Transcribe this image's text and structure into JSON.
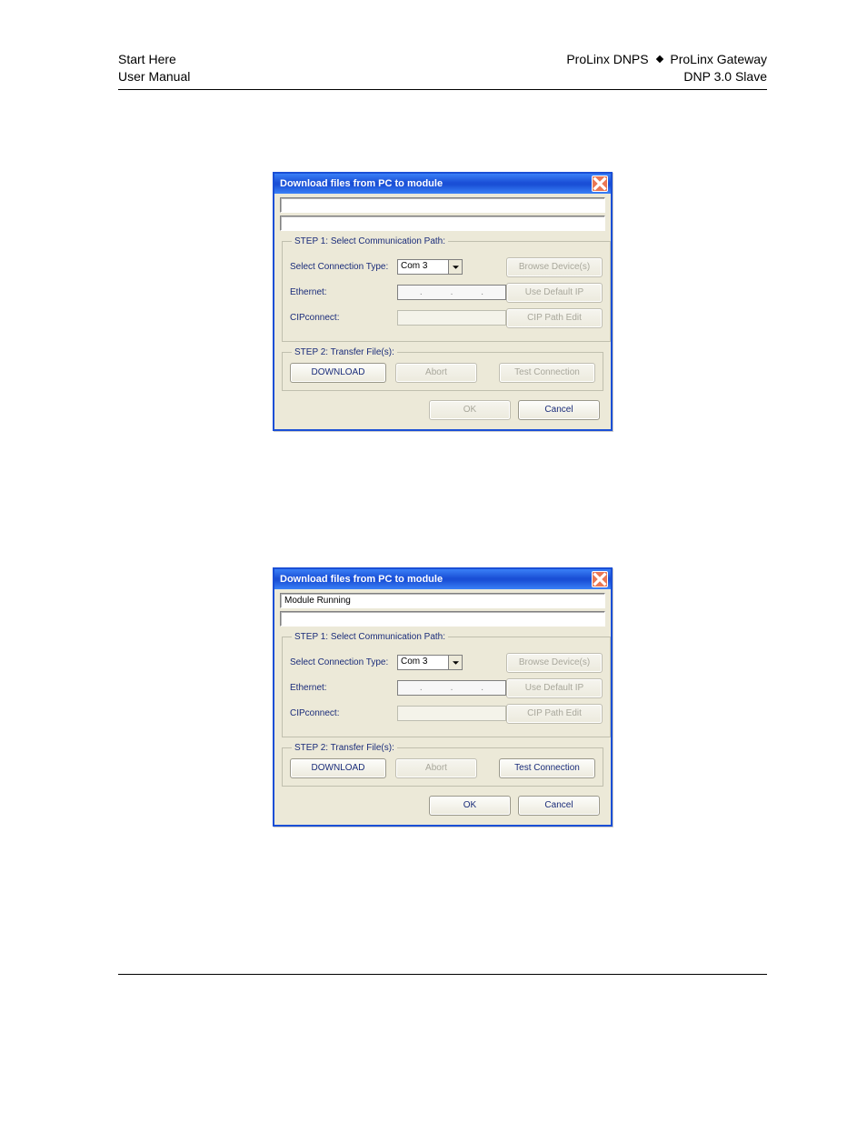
{
  "header": {
    "left_line1": "Start Here",
    "left_line2": "User Manual",
    "right_line1_a": "ProLinx DNPS",
    "right_line1_b": "ProLinx Gateway",
    "right_line2": "DNP 3.0 Slave"
  },
  "dialog1": {
    "title": "Download files from PC to module",
    "status1": "",
    "status2": "",
    "step1_legend": "STEP 1: Select Communication Path:",
    "select_conn_label": "Select Connection Type:",
    "select_conn_value": "Com 3",
    "browse_devices": "Browse Device(s)",
    "ethernet_label": "Ethernet:",
    "use_default_ip": "Use Default IP",
    "cipconnect_label": "CIPconnect:",
    "cip_path_edit": "CIP Path Edit",
    "step2_legend": "STEP 2: Transfer File(s):",
    "download": "DOWNLOAD",
    "abort": "Abort",
    "test_connection": "Test Connection",
    "ok": "OK",
    "cancel": "Cancel"
  },
  "dialog2": {
    "title": "Download files from PC to module",
    "status1": "Module Running",
    "status2": "",
    "step1_legend": "STEP 1: Select Communication Path:",
    "select_conn_label": "Select Connection Type:",
    "select_conn_value": "Com 3",
    "browse_devices": "Browse Device(s)",
    "ethernet_label": "Ethernet:",
    "use_default_ip": "Use Default IP",
    "cipconnect_label": "CIPconnect:",
    "cip_path_edit": "CIP Path Edit",
    "step2_legend": "STEP 2: Transfer File(s):",
    "download": "DOWNLOAD",
    "abort": "Abort",
    "test_connection": "Test Connection",
    "ok": "OK",
    "cancel": "Cancel"
  }
}
